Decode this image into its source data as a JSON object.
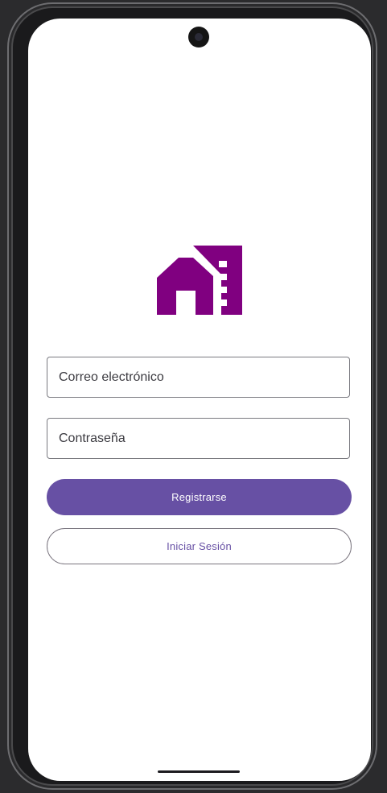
{
  "colors": {
    "primary": "#6750a4",
    "logo": "#800080",
    "outline": "#79747e"
  },
  "logo": {
    "icon": "house-building-icon"
  },
  "form": {
    "email_placeholder": "Correo electrónico",
    "password_placeholder": "Contraseña"
  },
  "buttons": {
    "register_label": "Registrarse",
    "login_label": "Iniciar Sesión"
  }
}
